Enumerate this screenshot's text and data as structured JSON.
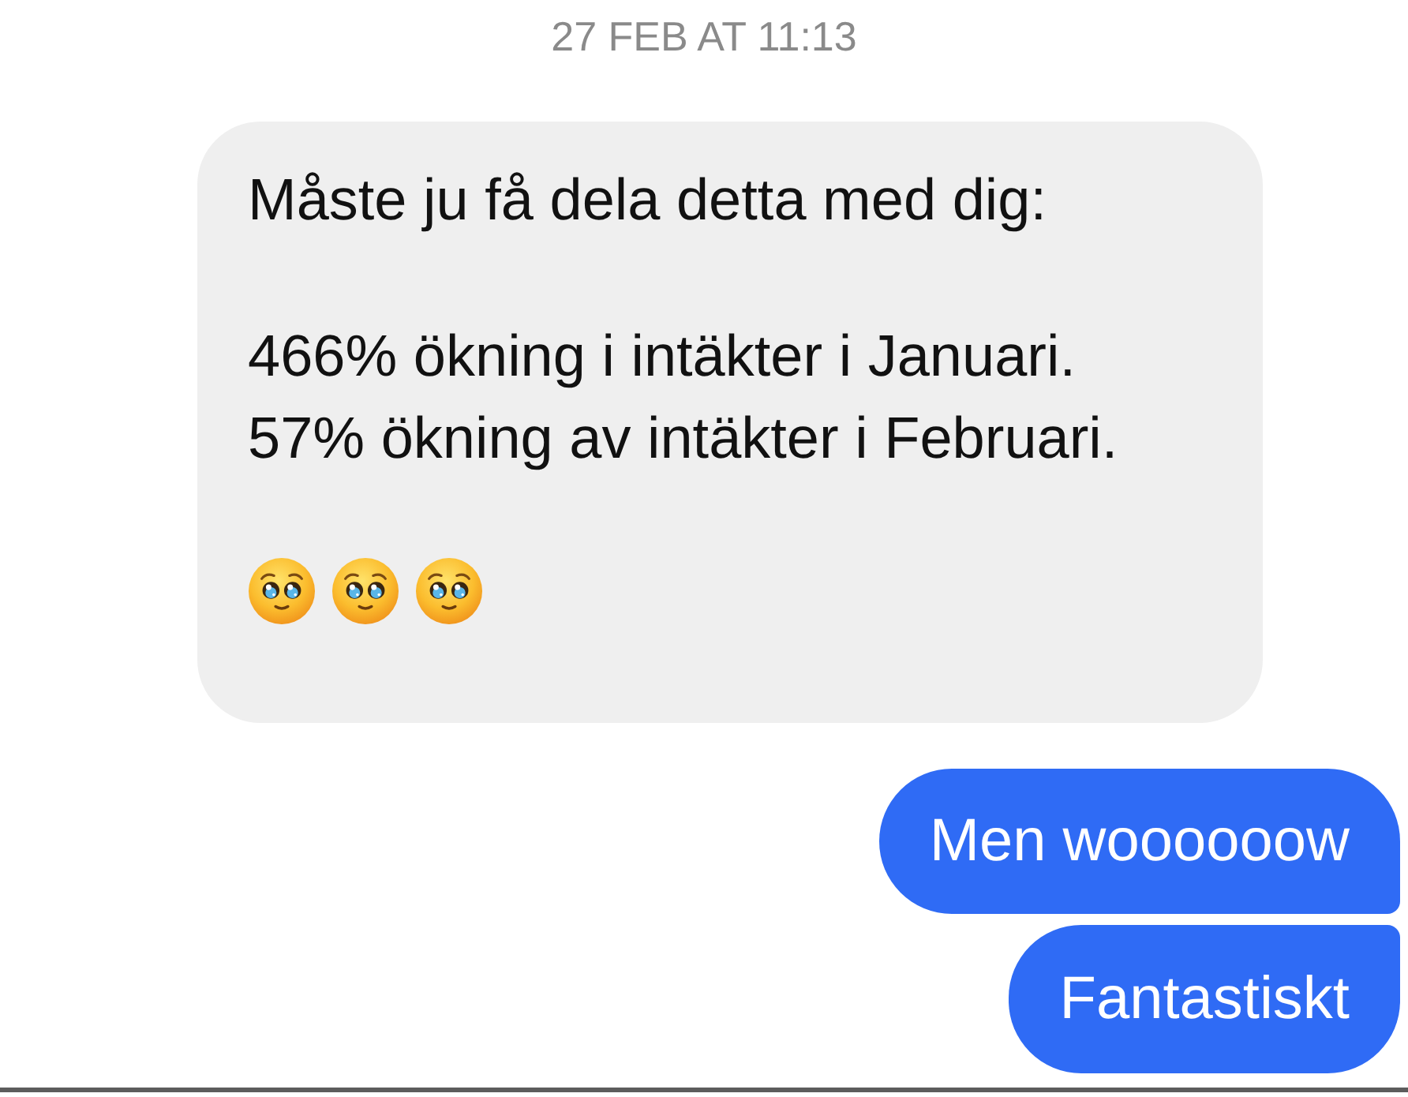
{
  "timestamp": "27 FEB AT 11:13",
  "messages": [
    {
      "kind": "received",
      "paragraphs": [
        "Måste ju få dela detta med dig:",
        "466% ökning i intäkter i Januari.\n57% ökning av intäkter i Februari."
      ],
      "emojis": [
        {
          "kind": "pleading-face"
        },
        {
          "kind": "pleading-face"
        },
        {
          "kind": "pleading-face"
        }
      ]
    },
    {
      "kind": "sent",
      "paragraphs": [
        "Men woooooow"
      ]
    },
    {
      "kind": "sent",
      "paragraphs": [
        "Fantastiskt"
      ]
    }
  ]
}
